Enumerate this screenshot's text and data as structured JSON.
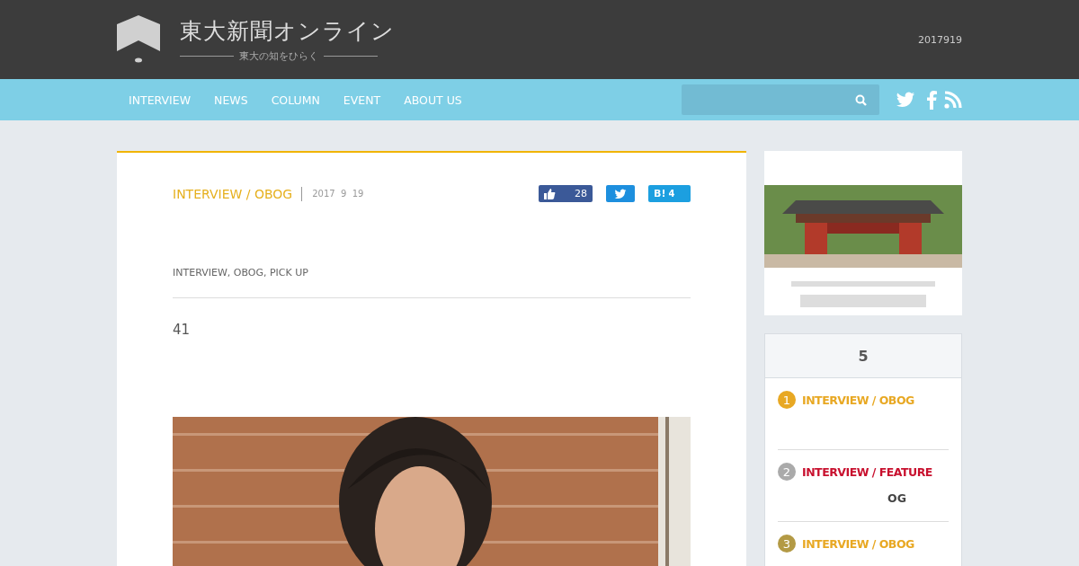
{
  "header": {
    "logo_title": "東大新聞オンライン",
    "logo_tagline": "東大の知をひらく",
    "date": "2017919"
  },
  "nav": {
    "items": [
      {
        "label": "INTERVIEW"
      },
      {
        "label": "NEWS"
      },
      {
        "label": "COLUMN"
      },
      {
        "label": "EVENT"
      },
      {
        "label": "ABOUT US"
      }
    ]
  },
  "article": {
    "category": "INTERVIEW / OBOG",
    "date": "2017  9  19",
    "share": [
      {
        "kind": "like",
        "count": "28"
      },
      {
        "kind": "tweet"
      },
      {
        "kind": "hatena",
        "label": "B!",
        "count": "4"
      }
    ],
    "tags": "INTERVIEW, OBOG, PICK UP",
    "body": "41"
  },
  "sidebar": {
    "ranking": {
      "title": "5",
      "items": [
        {
          "rank": "1",
          "color": "#e8a823",
          "category": {
            "label": "INTERVIEW / OBOG",
            "color": "#e8a823"
          }
        },
        {
          "rank": "2",
          "color": "#aaaaaa",
          "category": {
            "label": "INTERVIEW / FEATURE",
            "color": "#c8102e"
          },
          "title": "OG"
        },
        {
          "rank": "3",
          "color": "#b39a45",
          "category": {
            "label": "INTERVIEW / OBOG",
            "color": "#e8a823"
          }
        }
      ]
    }
  }
}
